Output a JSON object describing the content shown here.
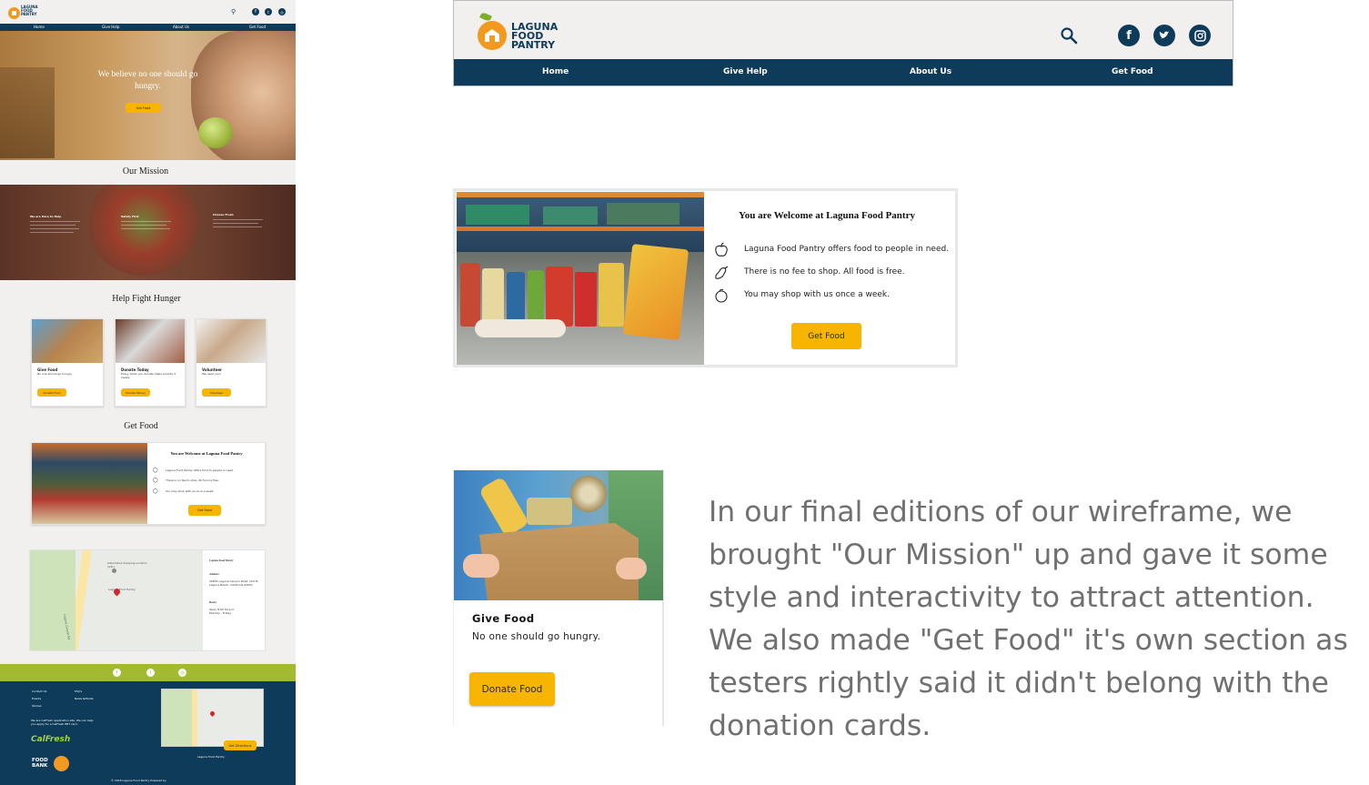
{
  "mockup": {
    "brand_lines": [
      "LAGUNA",
      "FOOD",
      "PANTRY"
    ],
    "nav": [
      "Home",
      "Give Help",
      "About Us",
      "Get Food"
    ],
    "hero_headline": "We believe no one should go hungry.",
    "hero_button": "Get Food",
    "mission_title": "Our Mission",
    "mission_columns": [
      {
        "heading": "We are Here to Help"
      },
      {
        "heading": "Safety First"
      },
      {
        "heading": "Choose Fresh"
      }
    ],
    "help_title": "Help Fight Hunger",
    "cards": [
      {
        "title": "Give Food",
        "desc": "No one should go hungry.",
        "button": "Donate Food"
      },
      {
        "title": "Donate Today",
        "desc": "Every dollar you donate helps provide 3 meals.",
        "button": "Donate Money"
      },
      {
        "title": "Volunteer",
        "desc": "We need you!",
        "button": "Volunteer"
      }
    ],
    "getfood_title": "Get Food",
    "getfood_card_title": "You are Welcome at Laguna Food Pantry",
    "getfood_items": [
      "Laguna Food Pantry offers food to people in need.",
      "There is no fee to shop. All food is free.",
      "You may shop with us once a week."
    ],
    "getfood_button": "Get Food",
    "map": {
      "pin_label": "Laguna Food Pantry",
      "alt_label": "Alternative Sleeping Location (ASL)",
      "road": "Laguna Canyon Rd",
      "name": "Laguna Food Pantry",
      "address_heading": "Address:",
      "address": "20652 Laguna Canyon Road, Unit B, Laguna Beach, California 92651",
      "hours_heading": "Hours",
      "hours": "Open 8:00 30 a.m. Monday - Friday"
    },
    "footer": {
      "col1": [
        "Contact Us",
        "Events",
        "Stories"
      ],
      "col2": [
        "FAQ's",
        "News &Media"
      ],
      "calfresh_note": "We are CalFresh application site. We can help you apply for a CalFresh EBT card.",
      "calfresh": "CalFresh",
      "foodbank_lines": [
        "FOOD",
        "BANK"
      ],
      "directions_button": "Get Directions",
      "pantry_name": "Laguna Food Pantry",
      "copyright": "© 2018 Laguna Food Pantry Powered by"
    }
  },
  "header_detail": {
    "brand_lines": [
      "LAGUNA",
      "FOOD",
      "PANTRY"
    ],
    "nav": [
      "Home",
      "Give Help",
      "About Us",
      "Get Food"
    ],
    "icons": [
      "search-icon",
      "facebook-icon",
      "twitter-icon",
      "instagram-icon"
    ]
  },
  "welcome_card": {
    "title": "You are Welcome at Laguna Food Pantry",
    "items": [
      "Laguna Food Pantry offers food to people in need.",
      "There is no fee to shop. All food is free.",
      "You may shop with us once a week."
    ],
    "button": "Get Food"
  },
  "give_card": {
    "title": "Give Food",
    "desc": "No one should go hungry.",
    "button": "Donate Food"
  },
  "note": "In our final editions of our wireframe, we brought \"Our Mission\" up and gave it some style and interactivity to attract attention. We also made \"Get Food\" it's own section as testers rightly said it didn't belong with the donation cards.",
  "colors": {
    "navy": "#0f3b5a",
    "accent": "#f7b400",
    "green": "#a2ba2f",
    "brand_orange": "#f29a1f"
  }
}
